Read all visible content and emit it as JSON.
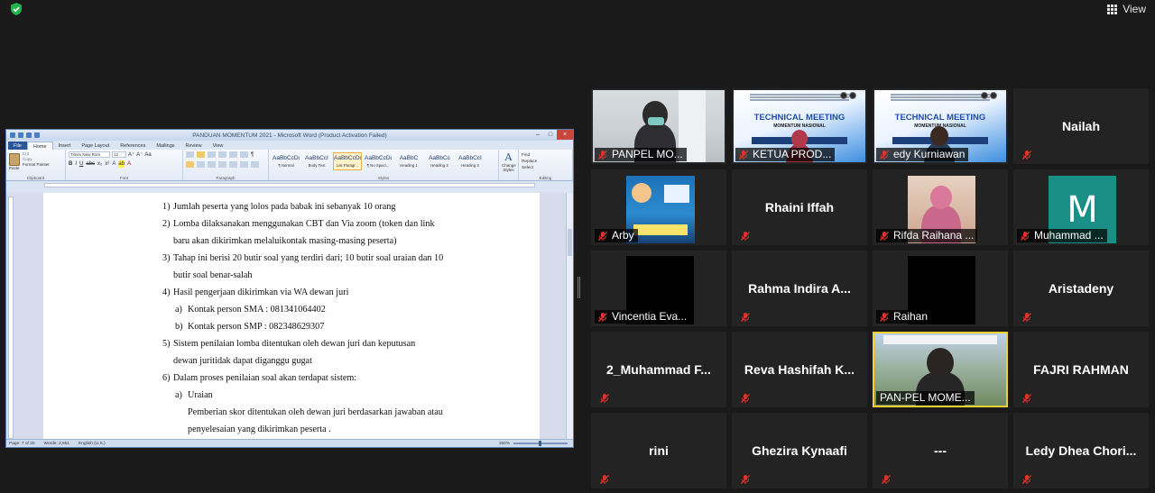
{
  "topbar": {
    "view_label": "View"
  },
  "word": {
    "title": "PANDUAN MOMENTUM 2021 - Microsoft Word (Product Activation Failed)",
    "tabs": [
      "File",
      "Home",
      "Insert",
      "Page Layout",
      "References",
      "Mailings",
      "Review",
      "View"
    ],
    "active_tab": "Home",
    "clipboard": {
      "paste": "Paste",
      "cut": "Cut",
      "copy": "Copy",
      "format_painter": "Format Painter",
      "label": "Clipboard"
    },
    "font": {
      "name": "Times New Rom",
      "size": "12",
      "label": "Font"
    },
    "paragraph_label": "Paragraph",
    "styles": [
      {
        "preview": "AaBbCcDc",
        "name": "¶ Normal"
      },
      {
        "preview": "AaBbCcI",
        "name": "Body Text"
      },
      {
        "preview": "AaBbCcDc",
        "name": "List Paragr..."
      },
      {
        "preview": "AaBbCcDc",
        "name": "¶ No Spaci..."
      },
      {
        "preview": "AaBbC",
        "name": "Heading 1"
      },
      {
        "preview": "AaBbCc",
        "name": "Heading 2"
      },
      {
        "preview": "AaBbCcI",
        "name": "Heading 3"
      }
    ],
    "active_style_index": 2,
    "styles_label": "Styles",
    "change_styles": "Change Styles",
    "editing": {
      "find": "Find",
      "replace": "Replace",
      "select": "Select",
      "label": "Editing"
    },
    "document_lines": [
      {
        "num": "1)",
        "text": "Jumlah peserta yang lolos pada babak ini sebanyak 10 orang",
        "indent": 0
      },
      {
        "num": "2)",
        "text": "Lomba  dilaksanakan  menggunakan  CBT dan Via zoom  (token dan link",
        "indent": 0
      },
      {
        "num": "",
        "text": "baru  akan  dikirimkan  melaluikontak  masing-masing peserta)",
        "indent": 1
      },
      {
        "num": "3)",
        "text": "Tahap ini berisi 20 butir soal yang terdiri dari; 10 butir soal uraian dan 10",
        "indent": 0
      },
      {
        "num": "",
        "text": "butir soal benar-salah",
        "indent": 1
      },
      {
        "num": "4)",
        "text": "Hasil pengerjaan dikirimkan via WA dewan juri",
        "indent": 0
      },
      {
        "num": "a)",
        "text": "Kontak person SMA : 081341064402",
        "indent": 2
      },
      {
        "num": "b)",
        "text": "Kontak person SMP : 082348629307",
        "indent": 2
      },
      {
        "num": "5)",
        "text": "Sistem  penilaian  lomba  ditentukan  oleh  dewan  juri  dan  keputusan",
        "indent": 0
      },
      {
        "num": "",
        "text": "dewan  juritidak dapat diganggu gugat",
        "indent": 1
      },
      {
        "num": "6)",
        "text": "Dalam proses penilaian soal akan terdapat sistem:",
        "indent": 0
      },
      {
        "num": "a)",
        "text": "Uraian",
        "indent": 2
      },
      {
        "num": "",
        "text": "Pemberian skor ditentukan oleh dewan juri berdasarkan jawaban atau",
        "indent": 3
      },
      {
        "num": "",
        "text": "penyelesaian yang dikirimkan peserta .",
        "indent": 3
      }
    ],
    "status": {
      "page": "Page: 7 of 20",
      "words": "Words: 2,551",
      "language": "English (U.S.)",
      "zoom": "150%"
    }
  },
  "tm_slide": {
    "title": "TECHNICAL MEETING",
    "subtitle": "MOMENTUM NASIONAL"
  },
  "participants": [
    {
      "name": "PANPEL MO...",
      "type": "video-room",
      "muted": true
    },
    {
      "name": "KETUA PROD...",
      "type": "video-tm",
      "muted": true
    },
    {
      "name": "edy Kurniawan",
      "type": "video-tm",
      "muted": true
    },
    {
      "name": "Nailah",
      "type": "name",
      "muted": true
    },
    {
      "name": "Arby",
      "type": "video-poster",
      "muted": true
    },
    {
      "name": "Rhaini Iffah",
      "type": "name",
      "muted": true
    },
    {
      "name": "Rifda Raihana ...",
      "type": "video-rifda",
      "muted": true
    },
    {
      "name": "Muhammad ...",
      "type": "avatar",
      "initial": "M",
      "muted": true
    },
    {
      "name": "Vincentia Eva...",
      "type": "video-black",
      "muted": true
    },
    {
      "name": "Rahma Indira A...",
      "type": "name",
      "muted": true
    },
    {
      "name": "Raihan",
      "type": "video-black",
      "muted": true
    },
    {
      "name": "Aristadeny",
      "type": "name",
      "muted": true
    },
    {
      "name": "2_Muhammad F...",
      "type": "name",
      "muted": true
    },
    {
      "name": "Reva Hashifah K...",
      "type": "name",
      "muted": true
    },
    {
      "name": "PAN-PEL MOME...",
      "type": "video-panpel",
      "muted": false,
      "active": true
    },
    {
      "name": "FAJRI RAHMAN",
      "type": "name",
      "muted": true
    },
    {
      "name": "rini",
      "type": "name",
      "muted": true
    },
    {
      "name": "Ghezira Kynaafi",
      "type": "name",
      "muted": true
    },
    {
      "name": "---",
      "type": "name",
      "muted": true
    },
    {
      "name": "Ledy Dhea Chori...",
      "type": "name",
      "muted": true
    }
  ],
  "colors": {
    "muted_icon": "#e0312c",
    "active_speaker": "#f2d12e",
    "shield": "#23b34a",
    "word_file_tab": "#2a5699"
  }
}
